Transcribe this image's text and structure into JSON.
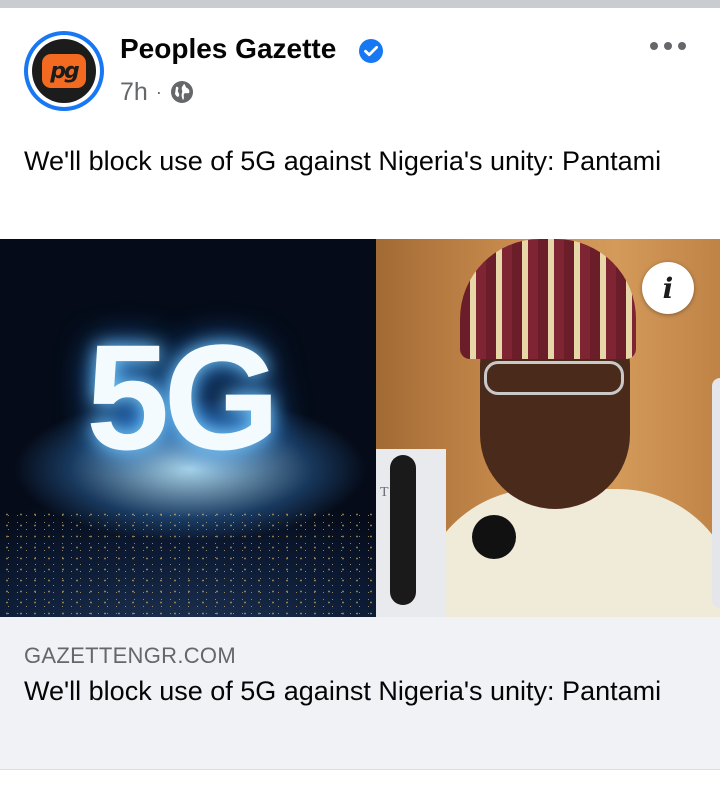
{
  "post": {
    "author": "Peoples Gazette",
    "verified": true,
    "time": "7h",
    "separator": "·",
    "audience_icon": "globe-icon",
    "more_icon": "more-horizontal-icon",
    "caption": "We'll block use of 5G against Nigeria's unity: Pantami"
  },
  "avatar": {
    "logo_text": "pg",
    "ring_color": "#1877f2",
    "logo_color": "#f36b21"
  },
  "photo": {
    "overlay_text": "5G",
    "podium_text": "TDA",
    "info_icon": "info-icon",
    "info_label": "i"
  },
  "link_preview": {
    "domain": "GAZETTENGR.COM",
    "title": "We'll block use of 5G against Nigeria's unity: Pantami"
  },
  "colors": {
    "accent": "#1877f2",
    "secondary_text": "#65676b",
    "link_bg": "#f0f2f5"
  }
}
